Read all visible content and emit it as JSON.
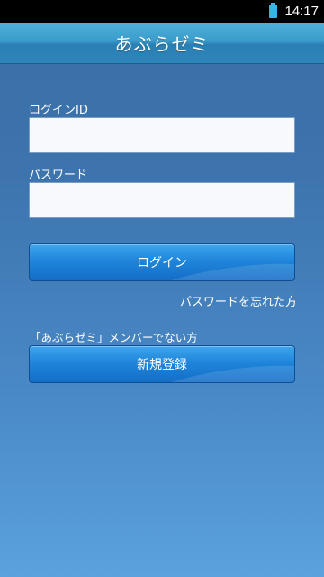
{
  "status_bar": {
    "time": "14:17",
    "battery_icon": "battery-icon"
  },
  "app_bar": {
    "title": "あぶらゼミ"
  },
  "login_form": {
    "login_id_label": "ログインID",
    "login_id_value": "",
    "password_label": "パスワード",
    "password_value": "",
    "login_button": "ログイン",
    "forgot_password_link": "パスワードを忘れた方"
  },
  "registration": {
    "prompt": "「あぶらゼミ」メンバーでない方",
    "register_button": "新規登録"
  },
  "colors": {
    "app_bar": "#3a9ccb",
    "button": "#1f86da",
    "background_top": "#3a6ea5",
    "background_bottom": "#5aa2de"
  }
}
